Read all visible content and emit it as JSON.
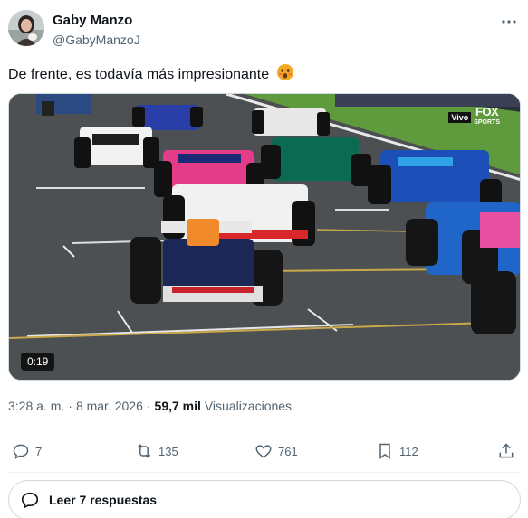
{
  "author": {
    "display_name": "Gaby Manzo",
    "handle": "@GabyManzoJ",
    "avatar_icon": "profile-photo"
  },
  "tweet": {
    "text": "De frente, es todavía más impresionante",
    "emoji": "astonished-face-emoji"
  },
  "media": {
    "duration": "0:19",
    "broadcaster_badge": "Vivo",
    "broadcaster_logo": "FOX",
    "broadcaster_logo_sub": "SPORTS"
  },
  "meta": {
    "time": "3:28 a. m.",
    "separator": "·",
    "date": "8 mar. 2026",
    "views_count": "59,7 mil",
    "views_label": "Visualizaciones"
  },
  "actions": {
    "replies": "7",
    "reposts": "135",
    "likes": "761",
    "bookmarks": "112"
  },
  "read_replies": {
    "label": "Leer 7 respuestas"
  },
  "colors": {
    "text_primary": "#0f1419",
    "text_secondary": "#536471",
    "border": "#cfd9de"
  }
}
